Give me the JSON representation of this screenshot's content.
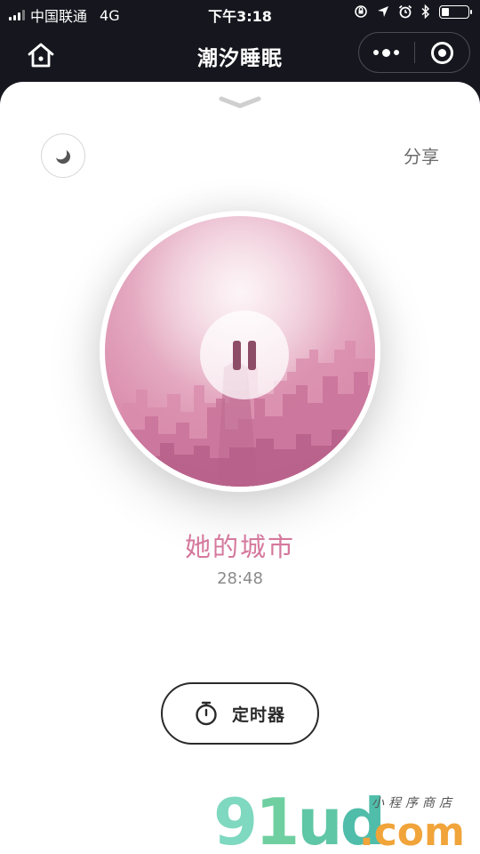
{
  "status_bar": {
    "carrier": "中国联通",
    "network": "4G",
    "time": "下午3:18",
    "battery_level": 0.3
  },
  "header": {
    "title": "潮汐睡眠",
    "home_icon": "home-icon",
    "more_icon": "more-icon",
    "close_icon": "target-icon"
  },
  "player": {
    "share_label": "分享",
    "mode_icon": "moon-icon",
    "collapse_icon": "chevron-down-icon",
    "track_title": "她的城市",
    "remaining_time": "28:48",
    "state": "playing",
    "accent": "#d5789d"
  },
  "timer": {
    "label": "定时器",
    "icon": "stopwatch-icon"
  },
  "watermark": {
    "text": "91ud",
    "domain": ".com",
    "subtitle": "小程序商店"
  }
}
